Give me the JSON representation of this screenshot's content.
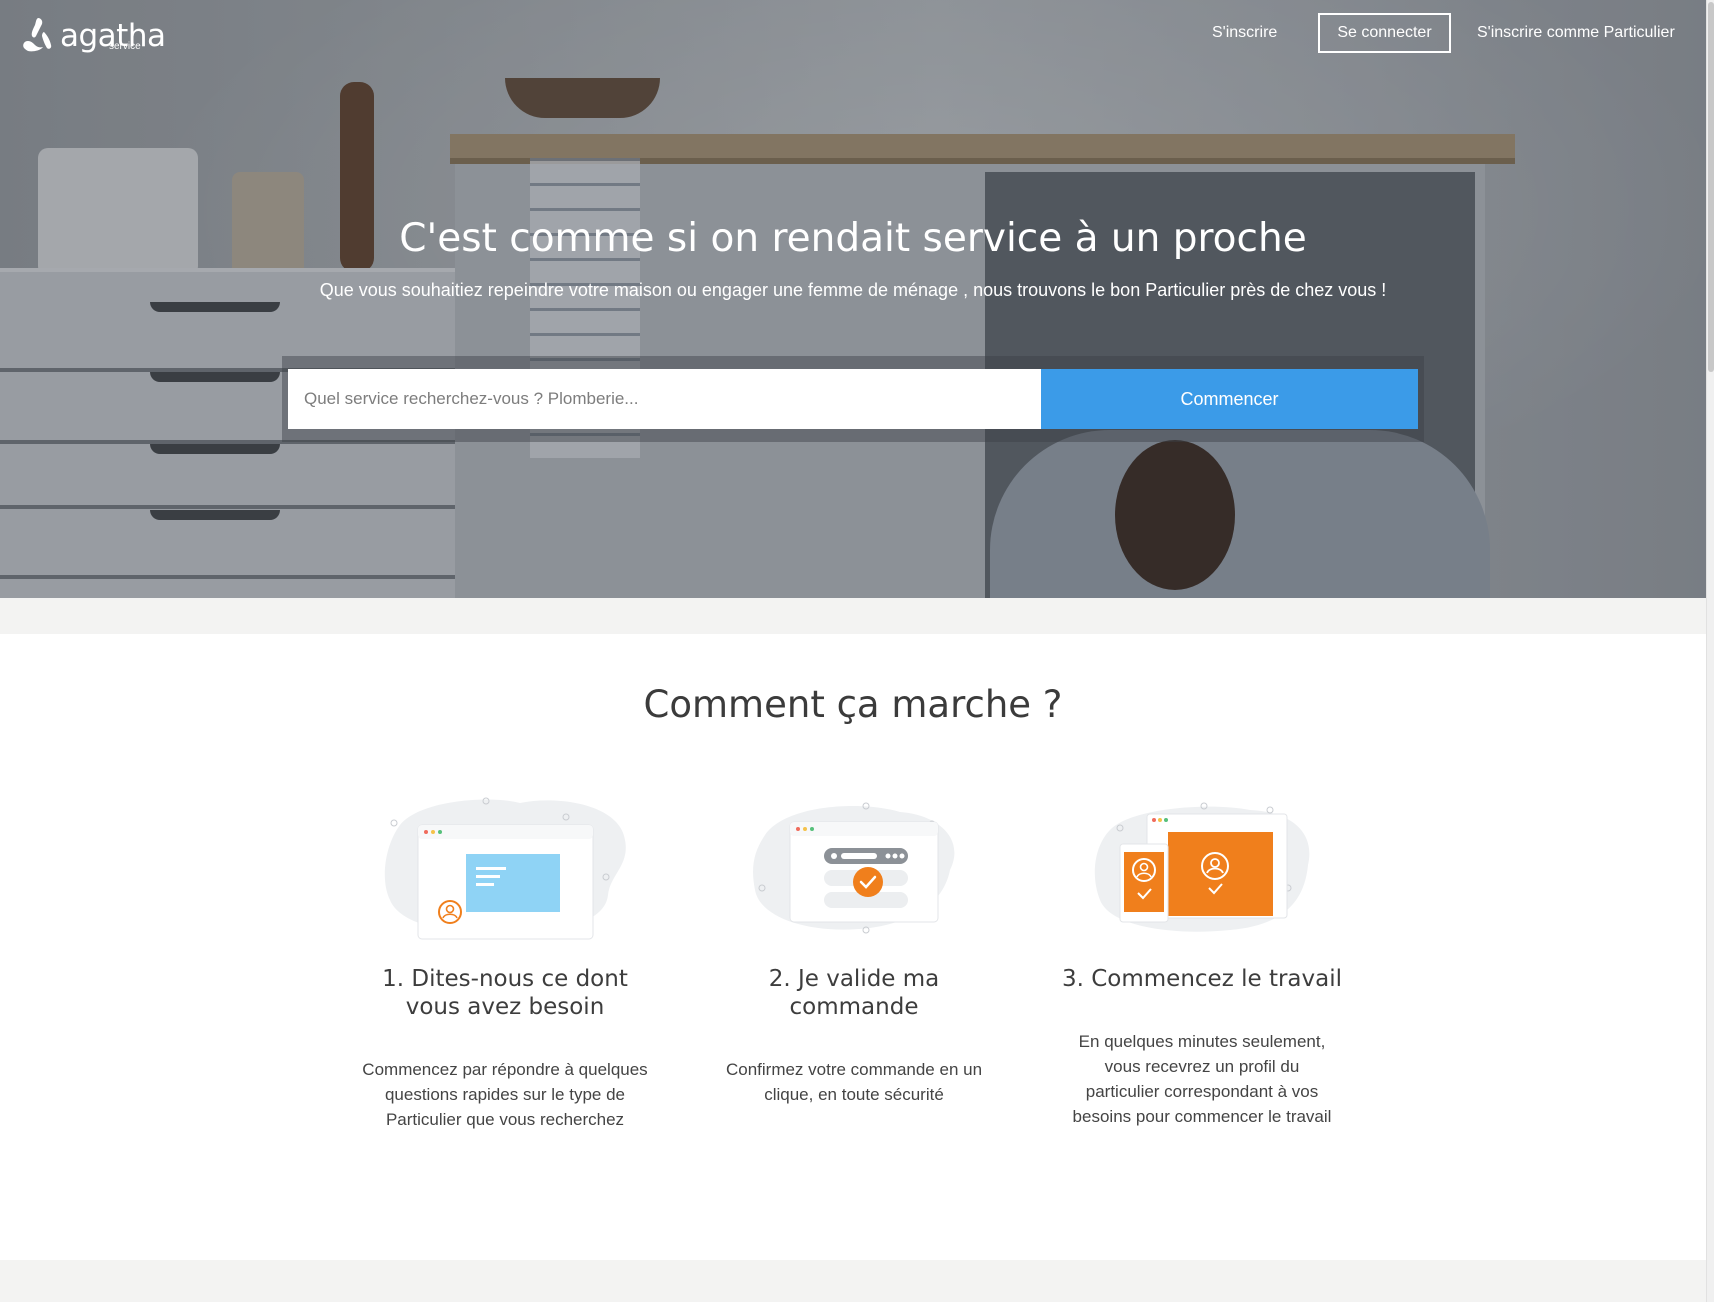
{
  "brand": {
    "name": "agatha",
    "sub": "service"
  },
  "nav": {
    "signup": "S'inscrire",
    "login": "Se connecter",
    "signup_particulier": "S'inscrire comme Particulier"
  },
  "hero": {
    "title": "C'est comme si on rendait service à un proche",
    "subtitle": "Que vous souhaitiez repeindre votre maison ou engager une femme de ménage , nous trouvons le bon Particulier près de chez vous !"
  },
  "search": {
    "placeholder": "Quel service recherchez-vous ? Plomberie...",
    "value": "",
    "button": "Commencer"
  },
  "how": {
    "title": "Comment ça marche ?",
    "steps": [
      {
        "title": "1. Dites-nous ce dont vous avez besoin",
        "text": "Commencez par répondre à quelques questions rapides sur le type de Particulier que vous recherchez",
        "icon": "chat-window-icon"
      },
      {
        "title": "2. Je valide ma commande",
        "text": "Confirmez votre commande en un clique, en toute sécurité",
        "icon": "checklist-window-icon"
      },
      {
        "title": "3. Commencez le travail",
        "text": "En quelques minutes seulement, vous recevrez un profil du particulier correspondant à vos besoins pour commencer le travail",
        "icon": "profile-devices-icon"
      }
    ]
  },
  "colors": {
    "accent_blue": "#3b9be8",
    "accent_orange": "#f07f1c",
    "light_blue": "#8fd3f5"
  }
}
